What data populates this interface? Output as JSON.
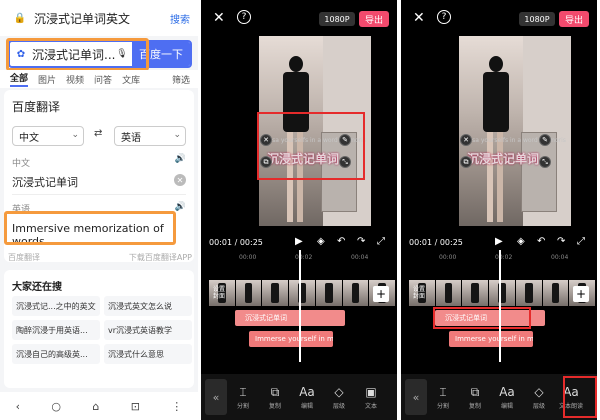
{
  "browser": {
    "url_query": "沉浸式记单词英文",
    "url_action": "搜索",
    "search_value": "沉浸式记单词...",
    "search_button": "百度一下",
    "tabs": [
      "全部",
      "图片",
      "视频",
      "问答",
      "文库"
    ],
    "filter_label": "筛选",
    "translate": {
      "title": "百度翻译",
      "source_lang": "中文",
      "target_lang": "英语",
      "source_label": "中文",
      "source_text": "沉浸式记单词",
      "target_label": "英语",
      "target_text": "Immersive memorization of words",
      "footer_left": "百度翻译",
      "footer_right": "下载百度翻译APP"
    },
    "related": {
      "title": "大家还在搜",
      "items": [
        "沉浸式记...之中的英文",
        "沉浸式英文怎么说",
        "陶醉沉浸于用英语...",
        "vr沉浸式英语教学",
        "沉浸自己的高级英...",
        "沉浸式什么意思"
      ]
    },
    "nav_icons": [
      "back-icon",
      "search-icon",
      "home-icon",
      "tabs-icon",
      "menu-icon"
    ],
    "nav_glyphs": [
      "‹",
      "○",
      "⌂",
      "⊡",
      "⋮"
    ]
  },
  "editors": [
    {
      "resolution": "1080P",
      "export_label": "导出",
      "overlay_small": "Tisa yourselfs in a word memoris",
      "overlay_cn": "沉浸式记单词",
      "time_current": "00:01",
      "time_total": "00:25",
      "ruler": [
        "00:00",
        "00:02",
        "00:04"
      ],
      "cover_label": "设置封面",
      "track_cn": "沉浸式记单词",
      "track_en": "Immerse yourself in memori",
      "tools": [
        {
          "icon": "split-icon",
          "glyph": "⌶",
          "label": "分割"
        },
        {
          "icon": "copy-icon",
          "glyph": "⧉",
          "label": "复制"
        },
        {
          "icon": "edit-text-icon",
          "glyph": "Aa",
          "label": "编辑"
        },
        {
          "icon": "layer-icon",
          "glyph": "◇",
          "label": "层级"
        },
        {
          "icon": "text-template-icon",
          "glyph": "▣",
          "label": "文本"
        }
      ]
    },
    {
      "resolution": "1080P",
      "export_label": "导出",
      "overlay_small": "Tisa yourselfs in a word memoris",
      "overlay_cn": "沉浸式记单词",
      "time_current": "00:01",
      "time_total": "00:25",
      "ruler": [
        "00:00",
        "00:02",
        "00:04"
      ],
      "cover_label": "设置封面",
      "track_cn": "沉浸式记单词",
      "track_en": "Immerse yourself in memori",
      "tools": [
        {
          "icon": "split-icon",
          "glyph": "⌶",
          "label": "分割"
        },
        {
          "icon": "copy-icon",
          "glyph": "⧉",
          "label": "复制"
        },
        {
          "icon": "edit-text-icon",
          "glyph": "Aa",
          "label": "编辑"
        },
        {
          "icon": "layer-icon",
          "glyph": "◇",
          "label": "层级"
        },
        {
          "icon": "text-recognize-icon",
          "glyph": "Aa",
          "label": "文本朗读"
        }
      ]
    }
  ],
  "colors": {
    "baidu_blue": "#4e6ef2",
    "highlight_orange": "#f59a3d",
    "highlight_red": "#e52b2b",
    "export_pink": "#f24a6d",
    "subtitle_track": "#f07a7a"
  }
}
